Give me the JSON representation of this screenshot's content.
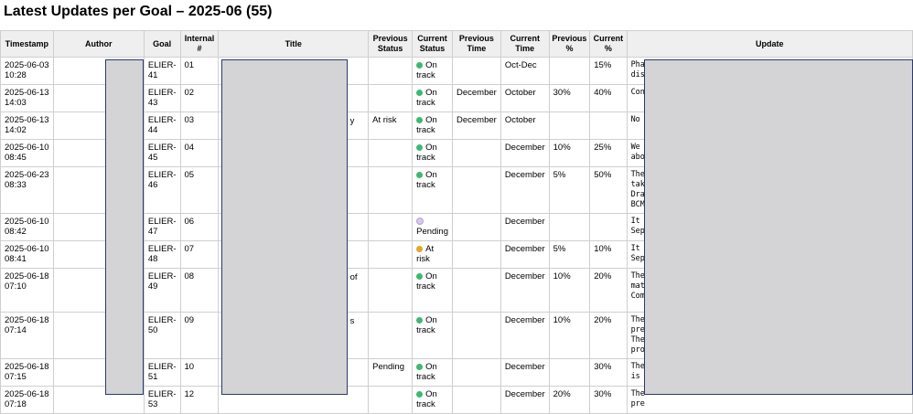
{
  "page": {
    "title": "Latest Updates per Goal – 2025-06 (55)"
  },
  "columns": [
    "Timestamp",
    "Author",
    "Goal",
    "Internal #",
    "Title",
    "Previous Status",
    "Current Status",
    "Previous Time",
    "Current Time",
    "Previous %",
    "Current %",
    "Update"
  ],
  "rows": [
    {
      "timestamp": "2025-06-03 10:28",
      "goal": "ELIER-41",
      "internal": "01",
      "title_tail": "",
      "prev_status": "",
      "cur_status": "On track",
      "status_color": "green",
      "prev_time": "",
      "cur_time": "Oct-Dec",
      "prev_pct": "",
      "cur_pct": "15%",
      "update": "Pha\ndis"
    },
    {
      "timestamp": "2025-06-13 14:03",
      "goal": "ELIER-43",
      "internal": "02",
      "title_tail": "",
      "prev_status": "",
      "cur_status": "On track",
      "status_color": "green",
      "prev_time": "December",
      "cur_time": "October",
      "prev_pct": "30%",
      "cur_pct": "40%",
      "update": "Con"
    },
    {
      "timestamp": "2025-06-13 14:02",
      "goal": "ELIER-44",
      "internal": "03",
      "title_tail": "y",
      "prev_status": "At risk",
      "cur_status": "On track",
      "status_color": "green",
      "prev_time": "December",
      "cur_time": "October",
      "prev_pct": "",
      "cur_pct": "",
      "update": "No"
    },
    {
      "timestamp": "2025-06-10 08:45",
      "goal": "ELIER-45",
      "internal": "04",
      "title_tail": "",
      "prev_status": "",
      "cur_status": "On track",
      "status_color": "green",
      "prev_time": "",
      "cur_time": "December",
      "prev_pct": "10%",
      "cur_pct": "25%",
      "update": "We\nabo"
    },
    {
      "timestamp": "2025-06-23 08:33",
      "goal": "ELIER-46",
      "internal": "05",
      "title_tail": "",
      "prev_status": "",
      "cur_status": "On track",
      "status_color": "green",
      "prev_time": "",
      "cur_time": "December",
      "prev_pct": "5%",
      "cur_pct": "50%",
      "update": "The\ntak\nDra\nBCM"
    },
    {
      "timestamp": "2025-06-10 08:42",
      "goal": "ELIER-47",
      "internal": "06",
      "title_tail": "",
      "prev_status": "",
      "cur_status": "Pending",
      "status_color": "purple",
      "prev_time": "",
      "cur_time": "December",
      "prev_pct": "",
      "cur_pct": "",
      "update": "It\nSep"
    },
    {
      "timestamp": "2025-06-10 08:41",
      "goal": "ELIER-48",
      "internal": "07",
      "title_tail": "",
      "prev_status": "",
      "cur_status": "At risk",
      "status_color": "yellow",
      "prev_time": "",
      "cur_time": "December",
      "prev_pct": "5%",
      "cur_pct": "10%",
      "update": "It\nSep"
    },
    {
      "timestamp": "2025-06-18 07:10",
      "goal": "ELIER-49",
      "internal": "08",
      "title_tail": "of",
      "prev_status": "",
      "cur_status": "On track",
      "status_color": "green",
      "prev_time": "",
      "cur_time": "December",
      "prev_pct": "10%",
      "cur_pct": "20%",
      "update": "The\nmat\nCom"
    },
    {
      "timestamp": "2025-06-18 07:14",
      "goal": "ELIER-50",
      "internal": "09",
      "title_tail": "s",
      "prev_status": "",
      "cur_status": "On track",
      "status_color": "green",
      "prev_time": "",
      "cur_time": "December",
      "prev_pct": "10%",
      "cur_pct": "20%",
      "update": "The\npre\nThe\npro"
    },
    {
      "timestamp": "2025-06-18 07:15",
      "goal": "ELIER-51",
      "internal": "10",
      "title_tail": "",
      "prev_status": "Pending",
      "cur_status": "On track",
      "status_color": "green",
      "prev_time": "",
      "cur_time": "December",
      "prev_pct": "",
      "cur_pct": "30%",
      "update": "The\nis"
    },
    {
      "timestamp": "2025-06-18 07:18",
      "goal": "ELIER-53",
      "internal": "12",
      "title_tail": "",
      "prev_status": "",
      "cur_status": "On track",
      "status_color": "green",
      "prev_time": "",
      "cur_time": "December",
      "prev_pct": "20%",
      "cur_pct": "30%",
      "update": "The\npre"
    }
  ]
}
